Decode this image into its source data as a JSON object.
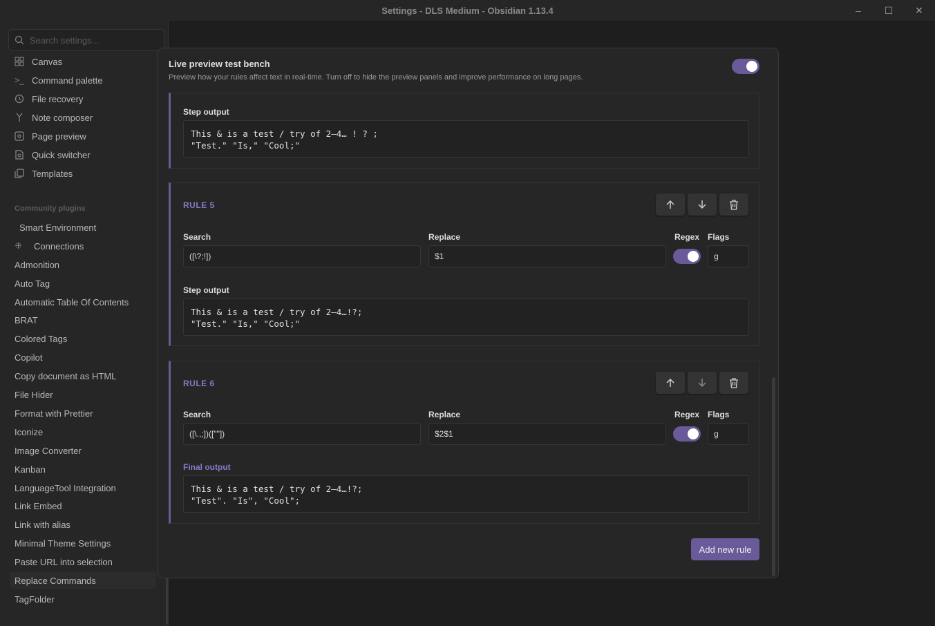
{
  "window": {
    "title": "Settings - DLS Medium - Obsidian 1.13.4",
    "minimize_icon": "–",
    "maximize_icon": "☐",
    "close_icon": "✕"
  },
  "sidebar": {
    "search_placeholder": "Search settings...",
    "core_items": [
      {
        "label": "Canvas",
        "icon": "canvas-icon"
      },
      {
        "label": "Command palette",
        "icon": "terminal-icon"
      },
      {
        "label": "File recovery",
        "icon": "history-icon"
      },
      {
        "label": "Note composer",
        "icon": "merge-icon"
      },
      {
        "label": "Page preview",
        "icon": "preview-icon"
      },
      {
        "label": "Quick switcher",
        "icon": "file-search-icon"
      },
      {
        "label": "Templates",
        "icon": "copy-icon"
      }
    ],
    "community_label": "Community plugins",
    "smart_env": "Smart Environment",
    "connections": "Connections",
    "plugins": [
      "Admonition",
      "Auto Tag",
      "Automatic Table Of Contents",
      "BRAT",
      "Colored Tags",
      "Copilot",
      "Copy document as HTML",
      "File Hider",
      "Format with Prettier",
      "Iconize",
      "Image Converter",
      "Kanban",
      "LanguageTool Integration",
      "Link Embed",
      "Link with alias",
      "Minimal Theme Settings",
      "Paste URL into selection",
      "Replace Commands",
      "TagFolder"
    ],
    "active_plugin": "Replace Commands"
  },
  "modal": {
    "live_preview": {
      "name": "Live preview test bench",
      "desc": "Preview how your rules affect text in real-time. Turn off to hide the preview panels and improve performance on long pages.",
      "enabled": true
    },
    "top_step": {
      "label": "Step output",
      "text": "This & is a test / try of 2–4… ! ? ;\n\"Test.\" \"Is,\" \"Cool;\""
    },
    "rule5": {
      "title": "RULE 5",
      "search_label": "Search",
      "replace_label": "Replace",
      "regex_label": "Regex",
      "flags_label": "Flags",
      "search_value": "([\\?;!])",
      "replace_value": "$1",
      "regex": true,
      "flags_value": "g",
      "output_label": "Step output",
      "output_text": "This & is a test / try of 2–4…!?;\n\"Test.\" \"Is,\" \"Cool;\""
    },
    "rule6": {
      "title": "RULE 6",
      "search_label": "Search",
      "replace_label": "Replace",
      "regex_label": "Regex",
      "flags_label": "Flags",
      "search_value": "([\\.,;])([\"\"])",
      "replace_value": "$2$1",
      "regex": true,
      "flags_value": "g",
      "output_label": "Final output",
      "output_text": "This & is a test / try of 2–4…!?;\n\"Test\". \"Is\", \"Cool\";"
    },
    "add_rule_label": "Add new rule"
  },
  "colors": {
    "accent": "#6a5a9a",
    "accent_text": "#8a78c8",
    "background": "#262626"
  }
}
